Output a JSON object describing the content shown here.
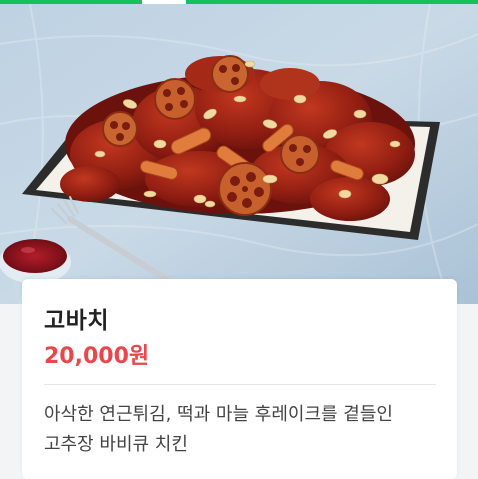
{
  "product": {
    "name": "고바치",
    "price": "20,000원",
    "description": "아삭한 연근튀김, 떡과 마늘 후레이크를 곁들인 고추장 바비큐 치킨"
  },
  "image": {
    "subject": "food-photo-chicken-plate"
  },
  "colors": {
    "accent_green": "#17c05a",
    "price_red": "#e8474b",
    "background": "#f3f4f6"
  }
}
